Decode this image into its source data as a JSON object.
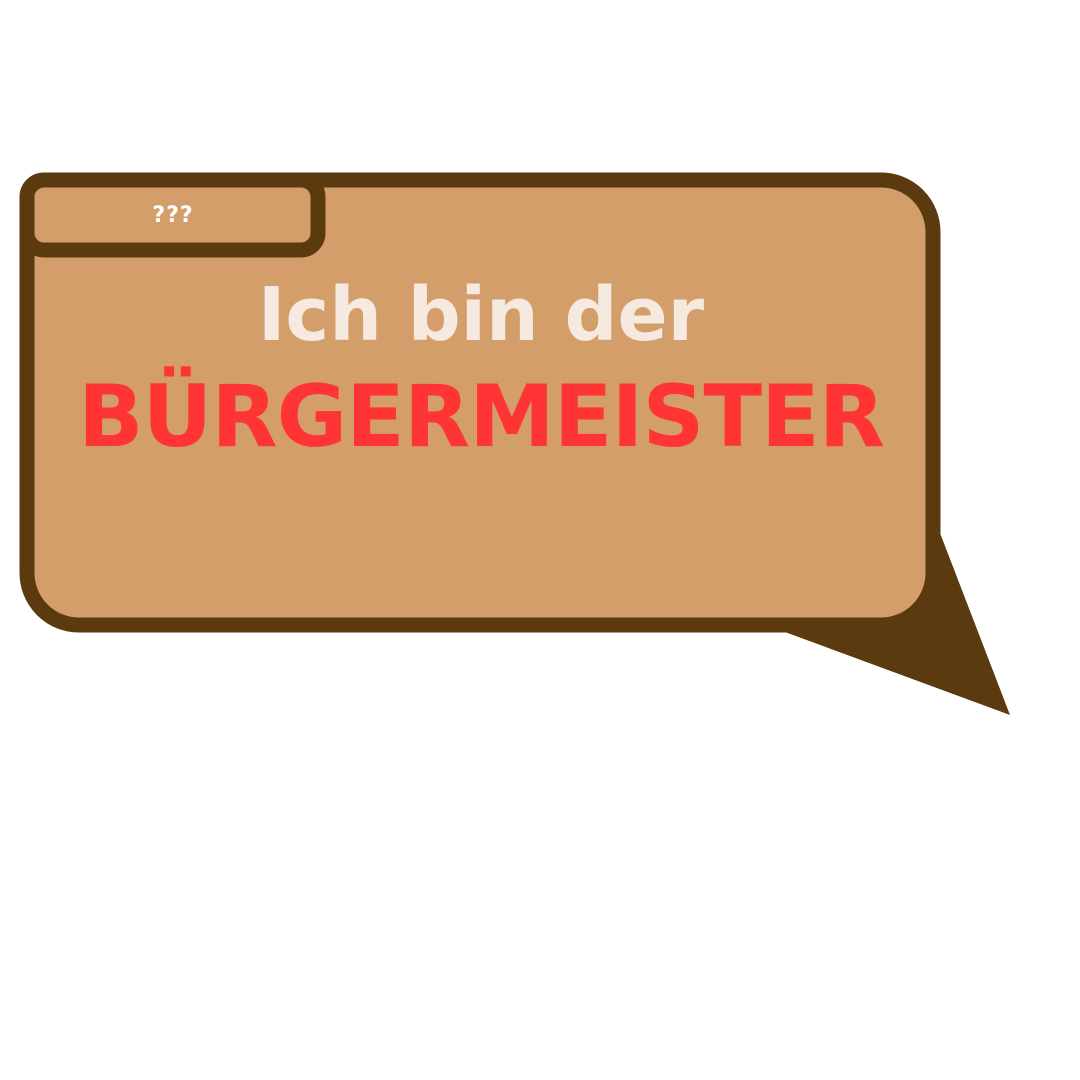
{
  "dialogue": {
    "speaker_name": "???",
    "line_1": "Ich bin der",
    "line_2": "BÜRGERMEISTER"
  },
  "colors": {
    "bubble_fill": "#d49e6a",
    "bubble_border": "#5c3a10",
    "speaker_text": "#ffffff",
    "line_1_text": "#f6e9df",
    "line_2_text": "#ff3535",
    "background": "#ffffff"
  }
}
